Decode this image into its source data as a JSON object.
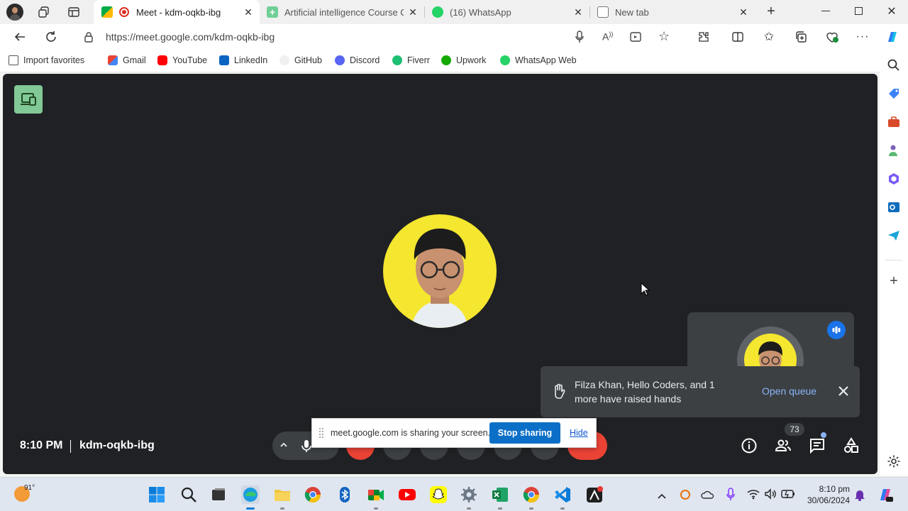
{
  "browser": {
    "tabs": [
      {
        "label": "Meet - kdm-oqkb-ibg",
        "active": true
      },
      {
        "label": "Artificial intelligence Course On",
        "active": false
      },
      {
        "label": "(16) WhatsApp",
        "active": false
      },
      {
        "label": "New tab",
        "active": false
      }
    ],
    "url": "https://meet.google.com/kdm-oqkb-ibg",
    "favorites": [
      "Import favorites",
      "Gmail",
      "YouTube",
      "LinkedIn",
      "GitHub",
      "Discord",
      "Fiverr",
      "Upwork",
      "WhatsApp Web"
    ]
  },
  "meet": {
    "time": "8:10 PM",
    "meeting_code": "kdm-oqkb-ibg",
    "raised_hands": {
      "line1": "Filza Khan, Hello Coders, and 1",
      "line2": "more have raised hands",
      "action": "Open queue"
    },
    "people_count": "73",
    "share_notice": {
      "message": "meet.google.com is sharing your screen.",
      "stop_label": "Stop sharing",
      "hide_label": "Hide"
    }
  },
  "taskbar": {
    "weather_temp": "91°",
    "time": "8:10 pm",
    "date": "30/06/2024"
  },
  "colors": {
    "stage_bg": "#202124",
    "avatar_bg": "#f5e62f",
    "leave_red": "#ea4335",
    "link_blue": "#8ab4f8",
    "stop_button": "#0b6fc7"
  }
}
